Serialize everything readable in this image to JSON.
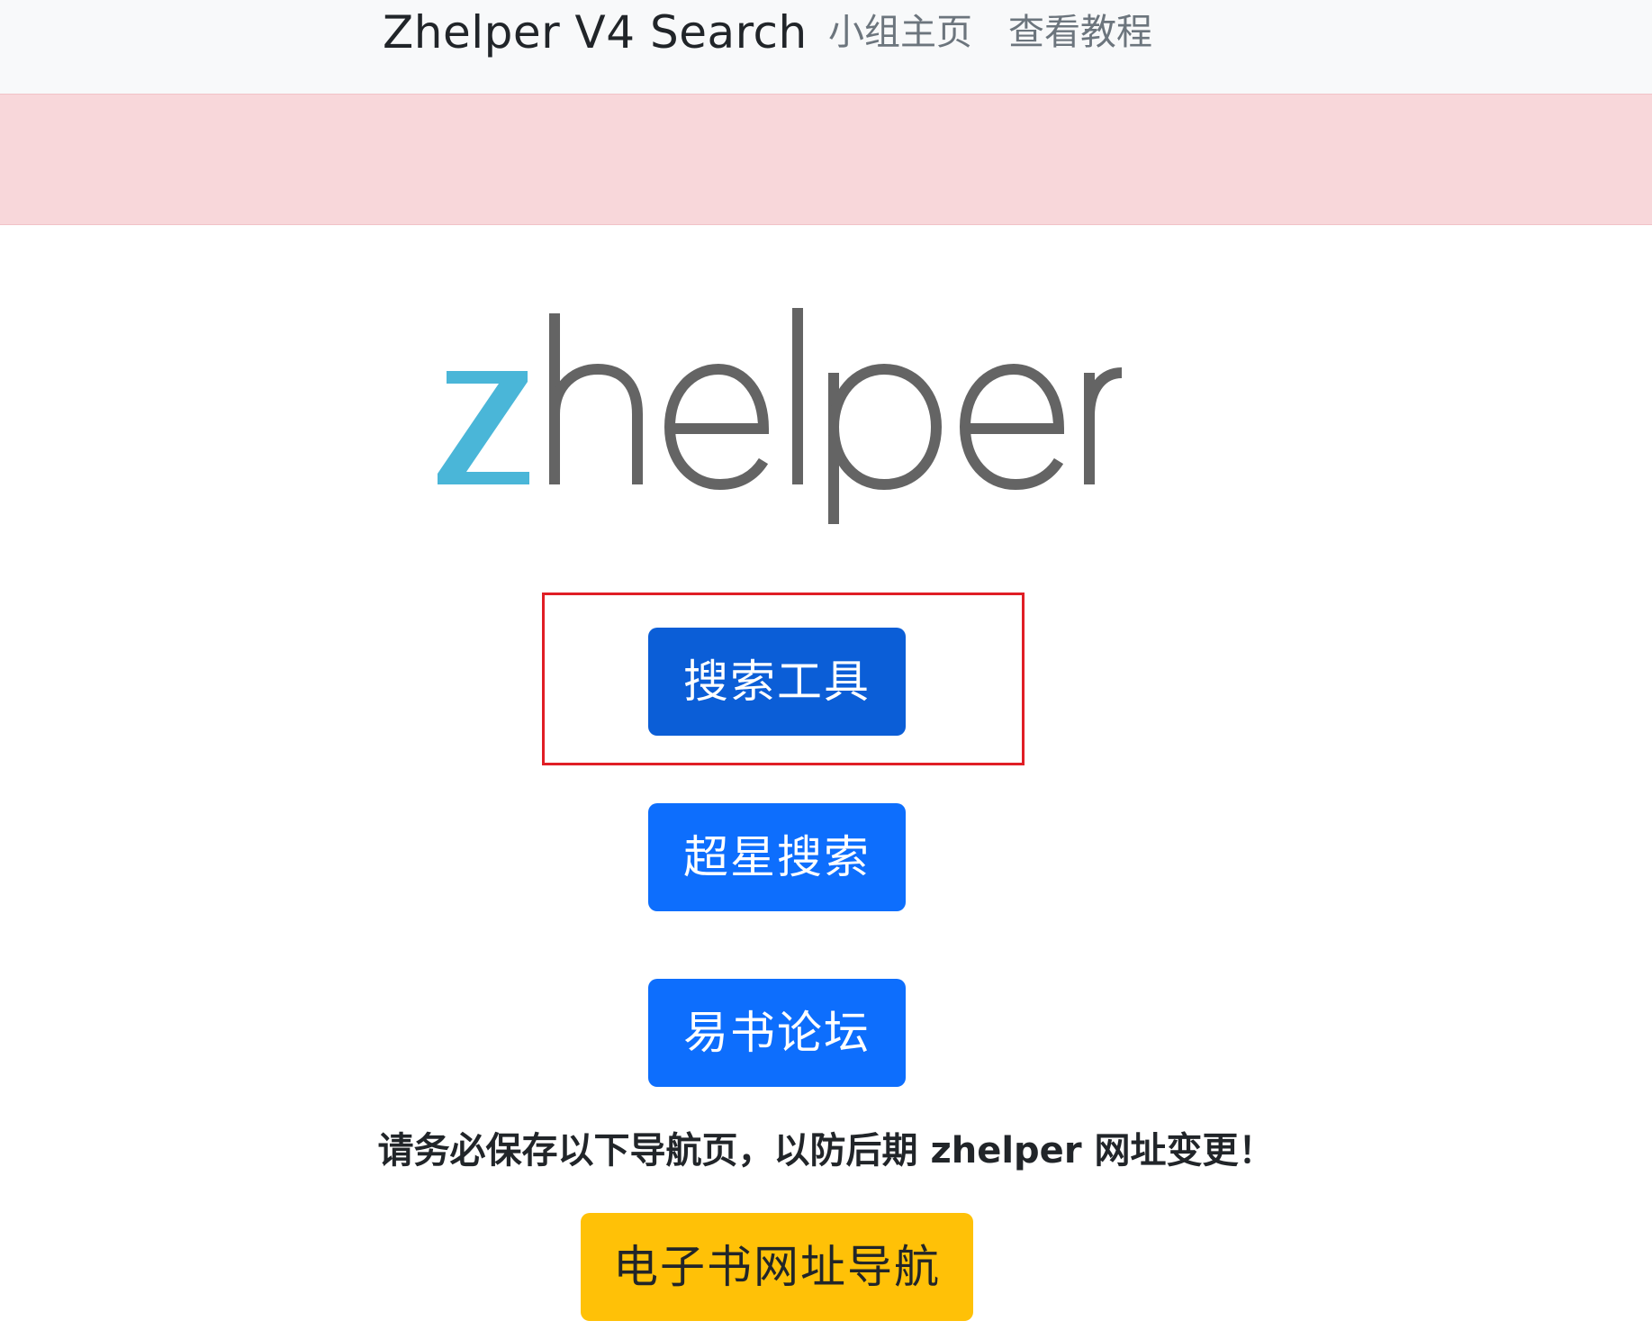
{
  "navbar": {
    "brand": "Zhelper V4 Search",
    "links": [
      {
        "label": "小组主页"
      },
      {
        "label": "查看教程"
      }
    ]
  },
  "logo": {
    "text": "zhelper",
    "z_color": "#4ab6d8",
    "rest_color": "#646464"
  },
  "buttons": {
    "search_tool": "搜索工具",
    "chaoxing_search": "超星搜索",
    "yishu_forum": "易书论坛",
    "ebook_nav": "电子书网址导航"
  },
  "notice": "请务必保存以下导航页，以防后期 zhelper 网址变更！",
  "colors": {
    "alert_bg": "#f8d7da",
    "primary_active": "#0b5ed7",
    "primary": "#0d6efd",
    "warning": "#ffc107",
    "highlight_border": "#e01e25"
  }
}
